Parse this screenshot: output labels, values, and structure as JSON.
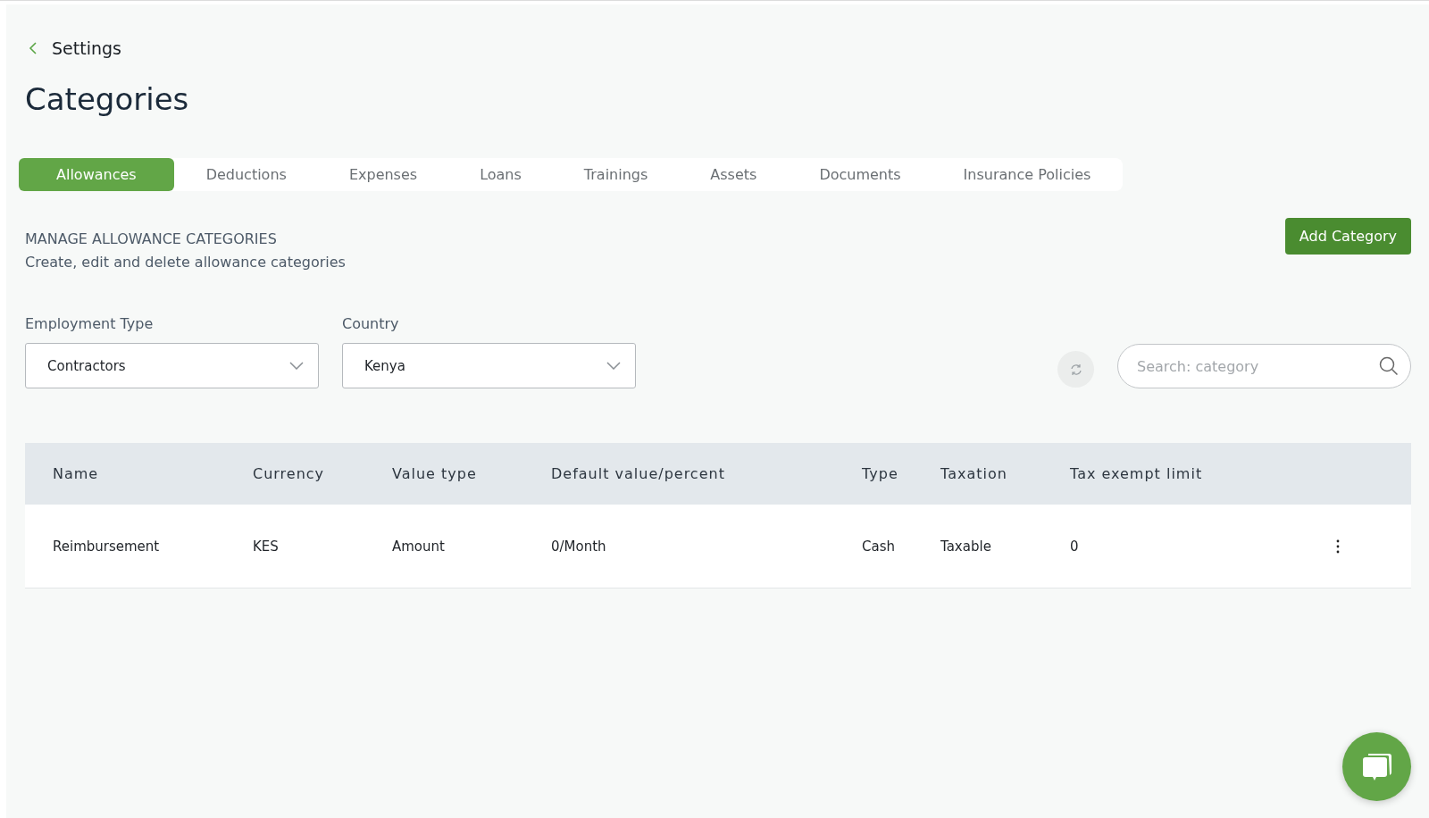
{
  "back": {
    "label": "Settings"
  },
  "title": "Categories",
  "tabs": [
    {
      "label": "Allowances",
      "selected": true
    },
    {
      "label": "Deductions",
      "selected": false
    },
    {
      "label": "Expenses",
      "selected": false
    },
    {
      "label": "Loans",
      "selected": false
    },
    {
      "label": "Trainings",
      "selected": false
    },
    {
      "label": "Assets",
      "selected": false
    },
    {
      "label": "Documents",
      "selected": false
    },
    {
      "label": "Insurance Policies",
      "selected": false
    }
  ],
  "section": {
    "heading": "MANAGE ALLOWANCE CATEGORIES",
    "description": "Create, edit and delete allowance categories",
    "button": "Add Category"
  },
  "filters": [
    {
      "label": "Employment Type",
      "value": "Contractors"
    },
    {
      "label": "Country",
      "value": "Kenya"
    }
  ],
  "search": {
    "placeholder": "Search: category"
  },
  "table": {
    "columns": [
      "Name",
      "Currency",
      "Value type",
      "Default value/percent",
      "Type",
      "Taxation",
      "Tax exempt limit"
    ],
    "rows": [
      [
        "Reimbursement",
        "KES",
        "Amount",
        "0/Month",
        "Cash",
        "Taxable",
        "0"
      ]
    ]
  }
}
